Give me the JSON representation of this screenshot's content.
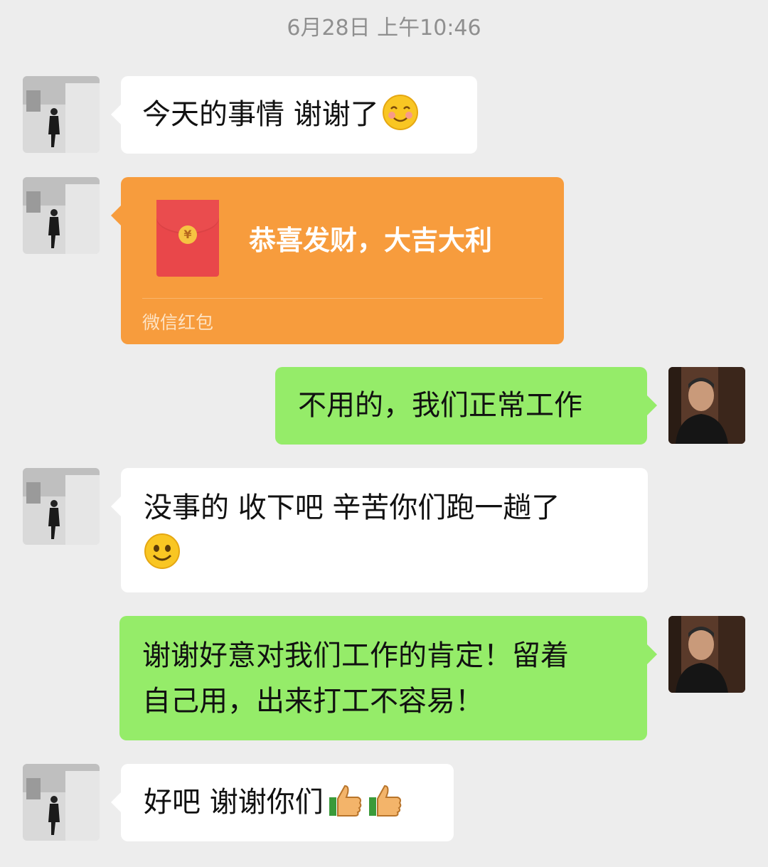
{
  "timestamp": "6月28日 上午10:46",
  "messages": {
    "m1": {
      "text": "今天的事情 谢谢了",
      "emoji": "blush-smile"
    },
    "m2": {
      "type": "red-packet",
      "title": "恭喜发财，大吉大利",
      "label": "微信红包"
    },
    "m3": {
      "text": "不用的，我们正常工作"
    },
    "m4": {
      "text": "没事的 收下吧 辛苦你们跑一趟了",
      "emoji": "smile"
    },
    "m5": {
      "line1": "谢谢好意对我们工作的肯定！留着",
      "line2": "自己用，出来打工不容易！"
    },
    "m6": {
      "text": "好吧 谢谢你们",
      "emoji": "thumbs-up"
    }
  },
  "colors": {
    "background": "#ededed",
    "incoming_bubble": "#ffffff",
    "outgoing_bubble": "#95ec69",
    "red_packet": "#f79c3d"
  }
}
